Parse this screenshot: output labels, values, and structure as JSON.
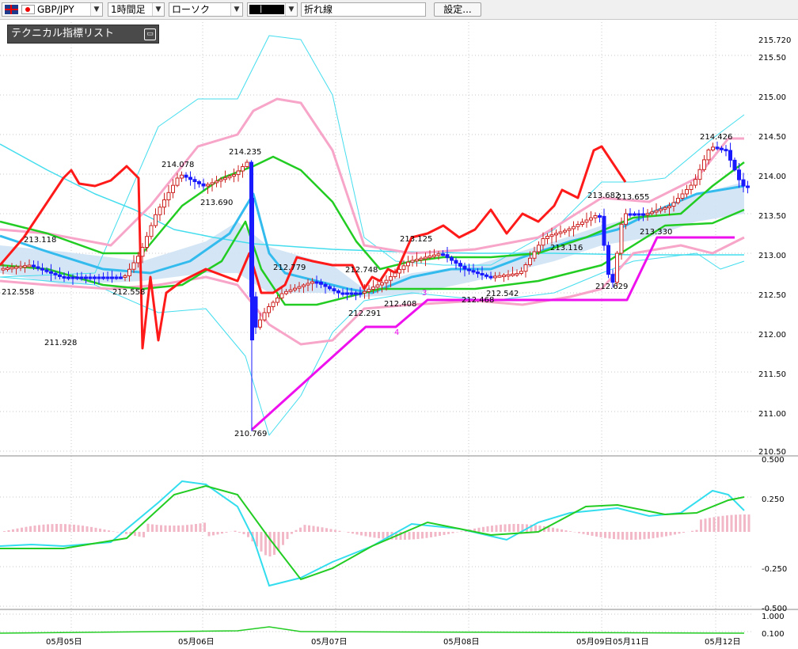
{
  "toolbar": {
    "pair": "GBP/JPY",
    "timeframe": "1時間足",
    "chart_style": "ローソク",
    "line_type": "折れ線",
    "settings_label": "設定..."
  },
  "indicator_panel": {
    "title": "テクニカル指標リスト",
    "close_icon": "minimize-icon"
  },
  "colors": {
    "bull": "#ffffff",
    "bear": "#1a1aff",
    "ma_short": "#ff1a1a",
    "ma_mid": "#22cc22",
    "bollinger_inner": "#f7a5c8",
    "bollinger_outer": "#44ddee",
    "zigzag": "#ee11ee",
    "cloud": "#cfe3f5"
  },
  "price_axis": [
    "215.720",
    "215.50",
    "215.00",
    "214.50",
    "214.00",
    "213.50",
    "213.00",
    "212.50",
    "212.00",
    "211.50",
    "211.00",
    "210.50"
  ],
  "macd_axis": [
    "0.500",
    "0.250",
    "-0.250",
    "-0.500",
    "1.000",
    "0.100"
  ],
  "date_axis": [
    "05月05日",
    "05月06日",
    "05月07日",
    "05月08日",
    "05月09日",
    "05月11日",
    "05月12日"
  ],
  "annotations": [
    "214.078",
    "214.235",
    "213.690",
    "213.118",
    "212.558",
    "212.558",
    "211.928",
    "212.779",
    "212.748",
    "212.291",
    "212.408",
    "213.125",
    "210.769",
    "213.116",
    "212.468",
    "212.542",
    "213.682",
    "213.655",
    "213.330",
    "212.629",
    "214.426"
  ],
  "zigzag_labels": [
    "3",
    "4"
  ],
  "chart_data": {
    "type": "line",
    "title": "GBP/JPY",
    "ylim": [
      210.5,
      215.72
    ],
    "x": [
      "05月05日",
      "05月06日",
      "05月07日",
      "05月08日",
      "05月09日",
      "05月11日",
      "05月12日"
    ],
    "series": [
      {
        "name": "zigzag",
        "values": [
          210.77,
          212.07,
          212.07,
          212.41,
          212.41,
          212.41,
          213.2,
          213.2
        ]
      }
    ]
  }
}
